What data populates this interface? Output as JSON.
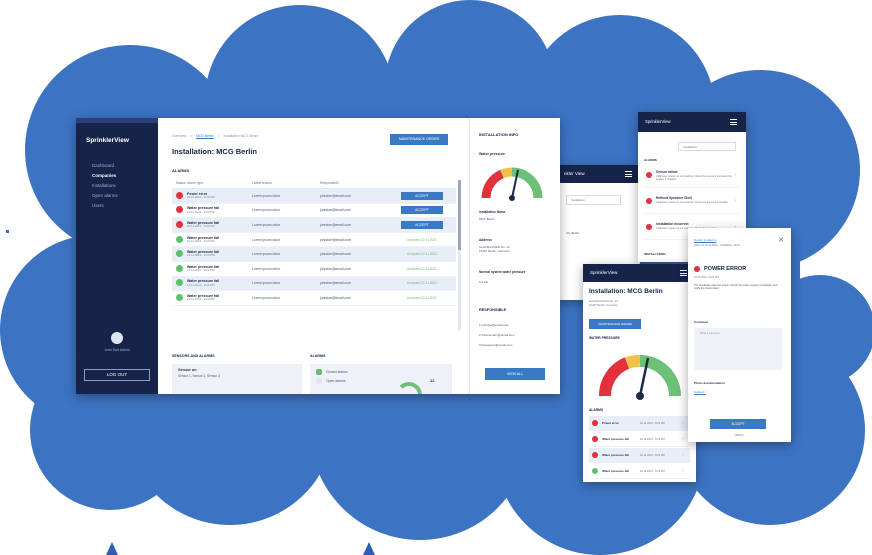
{
  "colors": {
    "cloud": "#3c73c2",
    "navy": "#16244a",
    "accent": "#3a7ac4",
    "alarm_red": "#e2313d",
    "ok_green": "#5fbf6a"
  },
  "desktop": {
    "brand": "SprinklerView",
    "nav": [
      "Dashboard",
      "Companies",
      "Installations",
      "Open alarms",
      "Users"
    ],
    "user_name": "John Doe Admin",
    "logout": "LOG OUT",
    "breadcrumb": [
      "Overview",
      ">",
      "MCG Berlin",
      ">",
      "Installation MCG Berlin"
    ],
    "maintenance_btn": "MAINTENANCE ORDER",
    "title": "Installation: MCG Berlin",
    "alarms_label": "ALARMS",
    "columns": [
      "Status",
      "Alarm type",
      "Latest lesson",
      "Responsible",
      ""
    ],
    "rows": [
      {
        "status": "red",
        "name": "Power error",
        "time": "22.11.2021 - 9:20 PM",
        "lesson": "Lorem ipsum dolor",
        "resp": "johndoe@email.com",
        "action": "ACCEPT"
      },
      {
        "status": "red",
        "name": "Water pressure fall",
        "time": "22.11.2021 - 9:20 PM",
        "lesson": "Lorem ipsum dolor",
        "resp": "johndoe@email.com",
        "action": "ACCEPT"
      },
      {
        "status": "red",
        "name": "Water pressure fall",
        "time": "22.11.2021 - 9:20 PM",
        "lesson": "Lorem ipsum dolor",
        "resp": "johndoe@email.com",
        "action": "ACCEPT"
      },
      {
        "status": "green",
        "name": "Water pressure fall",
        "time": "22.11.2021 - 9:20 PM",
        "lesson": "Lorem ipsum dolor",
        "resp": "johndoe@email.com",
        "action": "Accepted 22.11.2021"
      },
      {
        "status": "green",
        "name": "Water pressure fall",
        "time": "22.11.2021 - 9:20 PM",
        "lesson": "Lorem ipsum dolor",
        "resp": "johndoe@email.com",
        "action": "Accepted 22.11.2021"
      },
      {
        "status": "green",
        "name": "Water pressure fall",
        "time": "22.11.2021 - 9:20 PM",
        "lesson": "Lorem ipsum dolor",
        "resp": "johndoe@email.com",
        "action": "Accepted 22.11.2021"
      },
      {
        "status": "green",
        "name": "Water pressure fall",
        "time": "22.11.2021 - 9:20 PM",
        "lesson": "Lorem ipsum dolor",
        "resp": "johndoe@email.com",
        "action": "Accepted 22.11.2021"
      },
      {
        "status": "green",
        "name": "Water pressure fall",
        "time": "22.11.2021 - 9:20 PM",
        "lesson": "Lorem ipsum dolor",
        "resp": "johndoe@email.com",
        "action": "Accepted 22.11.2021"
      }
    ],
    "sensors_label": "SENSORS AND ALARMS",
    "sensors_title": "Sensor on",
    "sensors_list": "Sensor 1, Sensor 2, Sensor 3",
    "alarms2_label": "ALARMS",
    "legend": [
      "Closed alarms",
      "Open alarms"
    ],
    "alarm_count": "12"
  },
  "info": {
    "heading": "INSTALLATION INFO",
    "water_pressure": "Water pressure",
    "install_name_label": "Installation Name",
    "install_name": "MCG Berlin",
    "address_label": "Address",
    "address": [
      "Gustl-Burchardt-Str. 14",
      "10407 Berlin, Germany"
    ],
    "normal_label": "Normal system water pressure",
    "normal_value": "6,0 bar",
    "responsible_label": "RESPONSIBLE",
    "responsible": [
      "1  johndoe@email.com",
      "2  francismann@email.com",
      "3  davegreen@email.com"
    ],
    "view_all": "VIEW ALL"
  },
  "phone_a": {
    "header": "nkler View",
    "select": "Installation",
    "rows": [
      "d.k. Berlin",
      "",
      ""
    ]
  },
  "phone_b": {
    "header": "SprinklerView",
    "select": "Installation",
    "section": "ALARMS",
    "cards": [
      {
        "name": "Sensor failure",
        "desc": "Cellpower system is not working. Check the sensors and reset the system if needed",
        "status": "red"
      },
      {
        "name": "Refined Sprinkler Shell",
        "desc": "Cellpower system is not working. Check the sensors if needed",
        "status": "red"
      },
      {
        "name": "Installation incorrect",
        "desc": "Cellpower system is not working. Check the sensors",
        "status": "red"
      }
    ],
    "footer": "INSTALLATION"
  },
  "phone_c": {
    "header": "SprinklerView",
    "title": "Installation: MCG Berlin",
    "address": [
      "Gustl-Burchardt-Str. 14",
      "10407 Berlin, Germany"
    ],
    "maintenance_btn": "MAINTENANCE ORDER",
    "water_pressure": "WATER PRESSURE",
    "alarms_label": "ALARMS",
    "rows": [
      {
        "name": "Power error",
        "time": "22.11.2021 - 9:20 PM",
        "status": "red"
      },
      {
        "name": "Water pressure fall",
        "time": "22.11.2021 - 9:20 PM",
        "status": "red"
      },
      {
        "name": "Water pressure fall",
        "time": "22.11.2021 - 9:20 PM",
        "status": "red"
      },
      {
        "name": "Water pressure fall",
        "time": "22.11.2021 - 9:20 PM",
        "status": "green"
      }
    ]
  },
  "phone_d": {
    "link": "Return to Alarms",
    "sub": "Alarm id: 22.11.2021 - Installation: MCG",
    "error_title": "POWER ERROR",
    "date": "22.11.2021 - 9:20 PM",
    "desc": "The installation has lost power. Check the power supply immediately and notify the Grainmaker.",
    "comment_label": "Comment",
    "comment_placeholder": "Write a comment...",
    "photo_label": "Photo documentation",
    "upload": "Upload ↑",
    "accept": "ACCEPT",
    "back": "BACK"
  }
}
